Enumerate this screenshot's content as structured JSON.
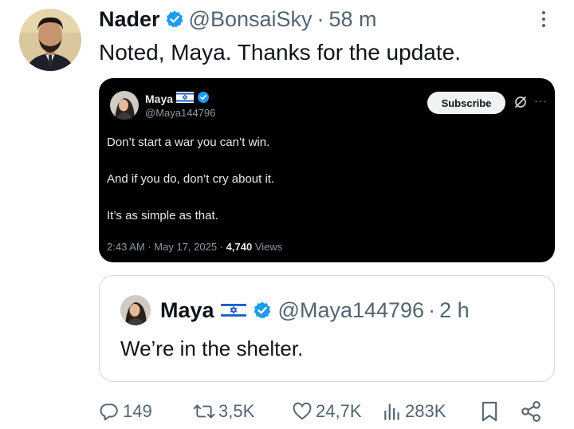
{
  "tweet": {
    "name": "Nader",
    "handle": "@BonsaiSky",
    "separator": "·",
    "time": "58 m",
    "text": "Noted, Maya. Thanks for the update."
  },
  "embedded_screenshot": {
    "name": "Maya",
    "handle": "@Maya144796",
    "subscribe_label": "Subscribe",
    "more_icon": "···",
    "lines": [
      "Don’t start a war you can’t win.",
      "And if you do, don’t cry about it.",
      "It’s as simple as that."
    ],
    "meta": {
      "time": "2:43 AM",
      "sep": "·",
      "date": "May 17, 2025",
      "views_count": "4,740",
      "views_label": "Views"
    }
  },
  "quote": {
    "name": "Maya",
    "handle": "@Maya144796",
    "separator": "·",
    "time": "2 h",
    "text": "We’re in the shelter."
  },
  "actions": {
    "replies": "149",
    "reposts": "3,5K",
    "likes": "24,7K",
    "views": "283K"
  },
  "colors": {
    "verified": "#1d9bf0",
    "secondary_text": "#536471",
    "screenshot_bg": "#000000"
  },
  "icons": [
    "verified-badge-icon",
    "israel-flag-icon",
    "reply-icon",
    "repost-icon",
    "like-icon",
    "views-icon",
    "bookmark-icon",
    "share-icon",
    "more-options-icon",
    "grok-icon"
  ]
}
